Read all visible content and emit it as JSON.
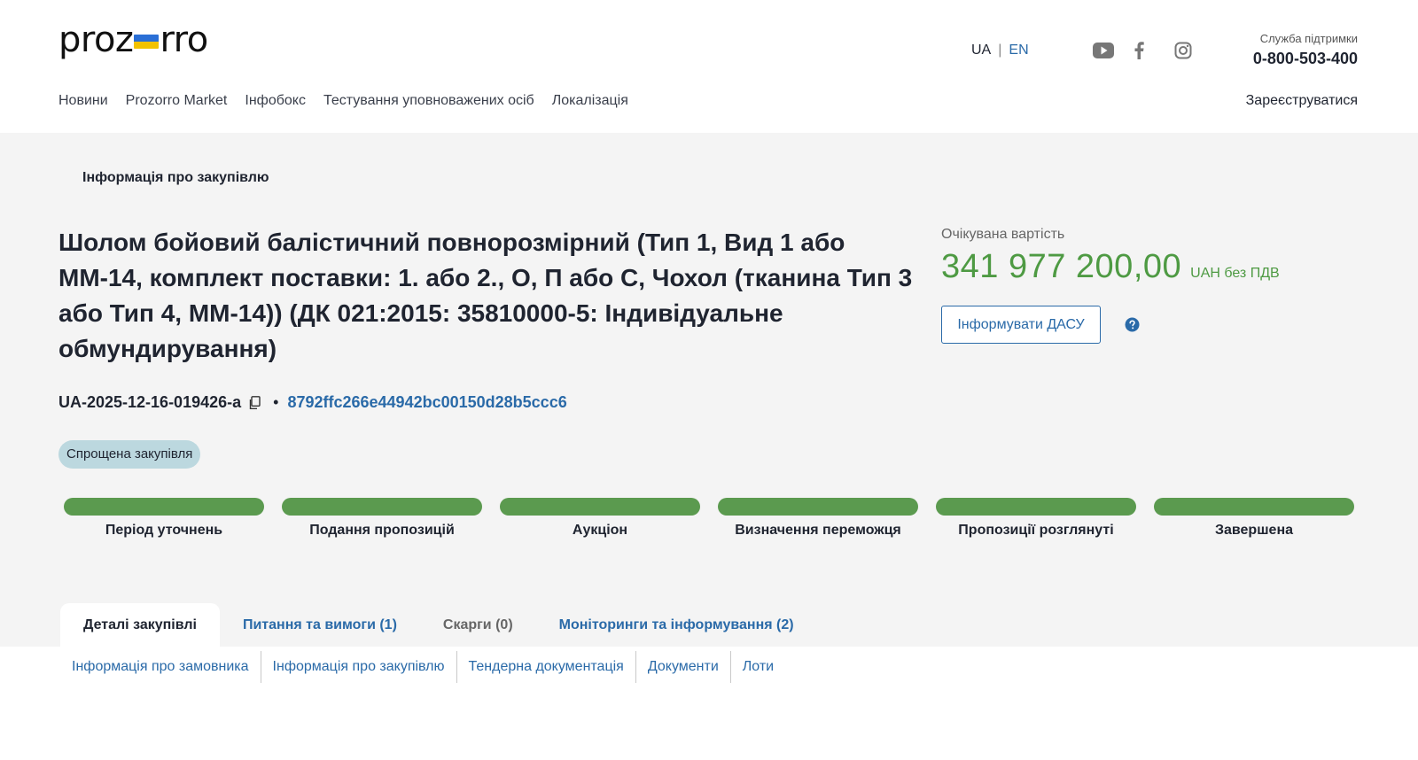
{
  "header": {
    "logo": {
      "left": "proz",
      "right": "rro"
    },
    "lang": {
      "ua": "UA",
      "separator": "|",
      "en": "EN"
    },
    "social": [
      "youtube-icon",
      "facebook-icon",
      "instagram-icon"
    ],
    "support": {
      "label": "Служба підтримки",
      "phone": "0-800-503-400"
    },
    "nav": [
      "Новини",
      "Prozorro Market",
      "Інфобокс",
      "Тестування уповноважених осіб",
      "Локалізація"
    ],
    "register": "Зареєструватися"
  },
  "breadcrumb": "Інформація про закупівлю",
  "tender": {
    "title": "Шолом бойовий балістичний повнорозмірний (Тип 1, Вид 1 або ММ-14, комплект поставки: 1. або 2., О, П або С, Чохол (тканина Тип 3 або Тип 4, ММ-14)) (ДК 021:2015: 35810000-5: Індивідуальне обмундирування)",
    "id": "UA-2025-12-16-019426-a",
    "dot": "•",
    "hash": "8792ffc266e44942bc00150d28b5ccc6",
    "type_badge": "Спрощена закупівля",
    "value_label": "Очікувана вартість",
    "amount": "341 977 200,00",
    "currency": "UAH без ПДВ",
    "inform_button": "Інформувати ДАСУ"
  },
  "stages": [
    {
      "name": "Період уточнень",
      "progress": 1.0
    },
    {
      "name": "Подання пропозицій",
      "progress": 1.0
    },
    {
      "name": "Аукціон",
      "progress": 1.0
    },
    {
      "name": "Визначення переможця",
      "progress": 1.0
    },
    {
      "name": "Пропозиції розглянуті",
      "progress": 1.0
    },
    {
      "name": "Завершена",
      "progress": 1.0
    }
  ],
  "tabs": [
    "Деталі закупівлі",
    "Питання та вимоги (1)",
    "Скарги (0)",
    "Моніторинги та інформування (2)"
  ],
  "subnav": [
    "Інформація про замовника",
    "Інформація про закупівлю",
    "Тендерна документація",
    "Документи",
    "Лоти"
  ],
  "colors": {
    "accent": "#2a6aa8",
    "success": "#5b9a4f",
    "amount": "#4e9a43",
    "badge": "#bcd8df"
  }
}
